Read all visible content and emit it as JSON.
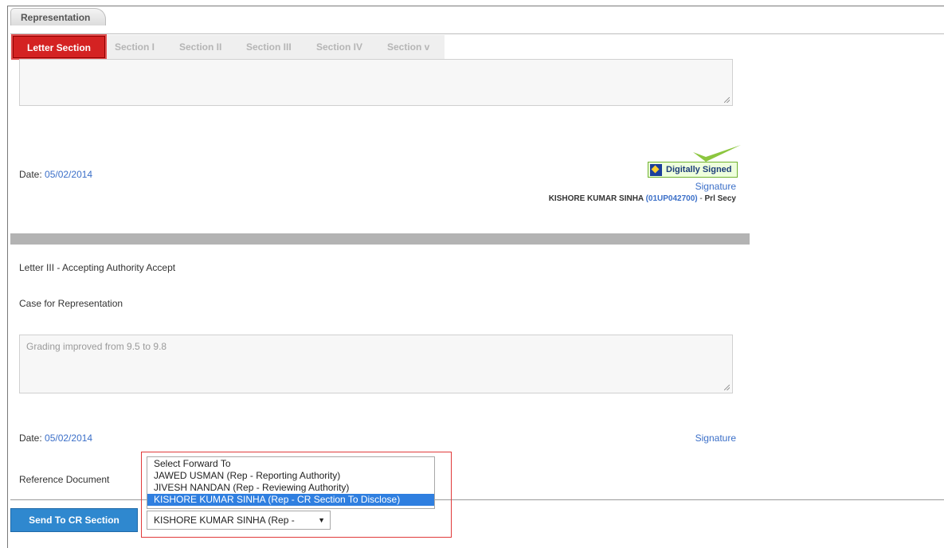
{
  "top_tab": "Representation",
  "section_tabs": [
    "Letter Section",
    "Section I",
    "Section II",
    "Section III",
    "Section IV",
    "Section v"
  ],
  "letter1": {
    "date_label": "Date:",
    "date_value": "05/02/2014",
    "badge_text": "Digitally Signed",
    "signature_link": "Signature",
    "signer_name": "KISHORE KUMAR SINHA",
    "signer_id": "(01UP042700)",
    "signer_dash": "-",
    "signer_post": "Prl Secy"
  },
  "letter3": {
    "heading": "Letter III - Accepting Authority Accept",
    "case_label": "Case for Representation",
    "case_text": "Grading improved from 9.5 to 9.8",
    "date_label": "Date:",
    "date_value": "05/02/2014",
    "signature_link": "Signature",
    "reference_label": "Reference Document"
  },
  "send_button": "Send To CR Section",
  "forward_list": {
    "options": [
      "Select Forward To",
      "JAWED USMAN (Rep - Reporting Authority)",
      "JIVESH NANDAN (Rep - Reviewing Authority)",
      "KISHORE KUMAR SINHA (Rep - CR Section To Disclose)"
    ],
    "selected": "KISHORE KUMAR SINHA (Rep - CR Section To Disclose)",
    "select_display": "KISHORE KUMAR SINHA (Rep -"
  },
  "icons": {
    "checkmark": "check-icon",
    "badge": "digital-sign-icon",
    "dropdown": "chevron-down-icon"
  },
  "colors": {
    "active_tab": "#d42222",
    "link": "#3b6fc8",
    "button": "#2f88cf",
    "selected_option": "#2f7fe0",
    "check": "#8cc63f"
  }
}
